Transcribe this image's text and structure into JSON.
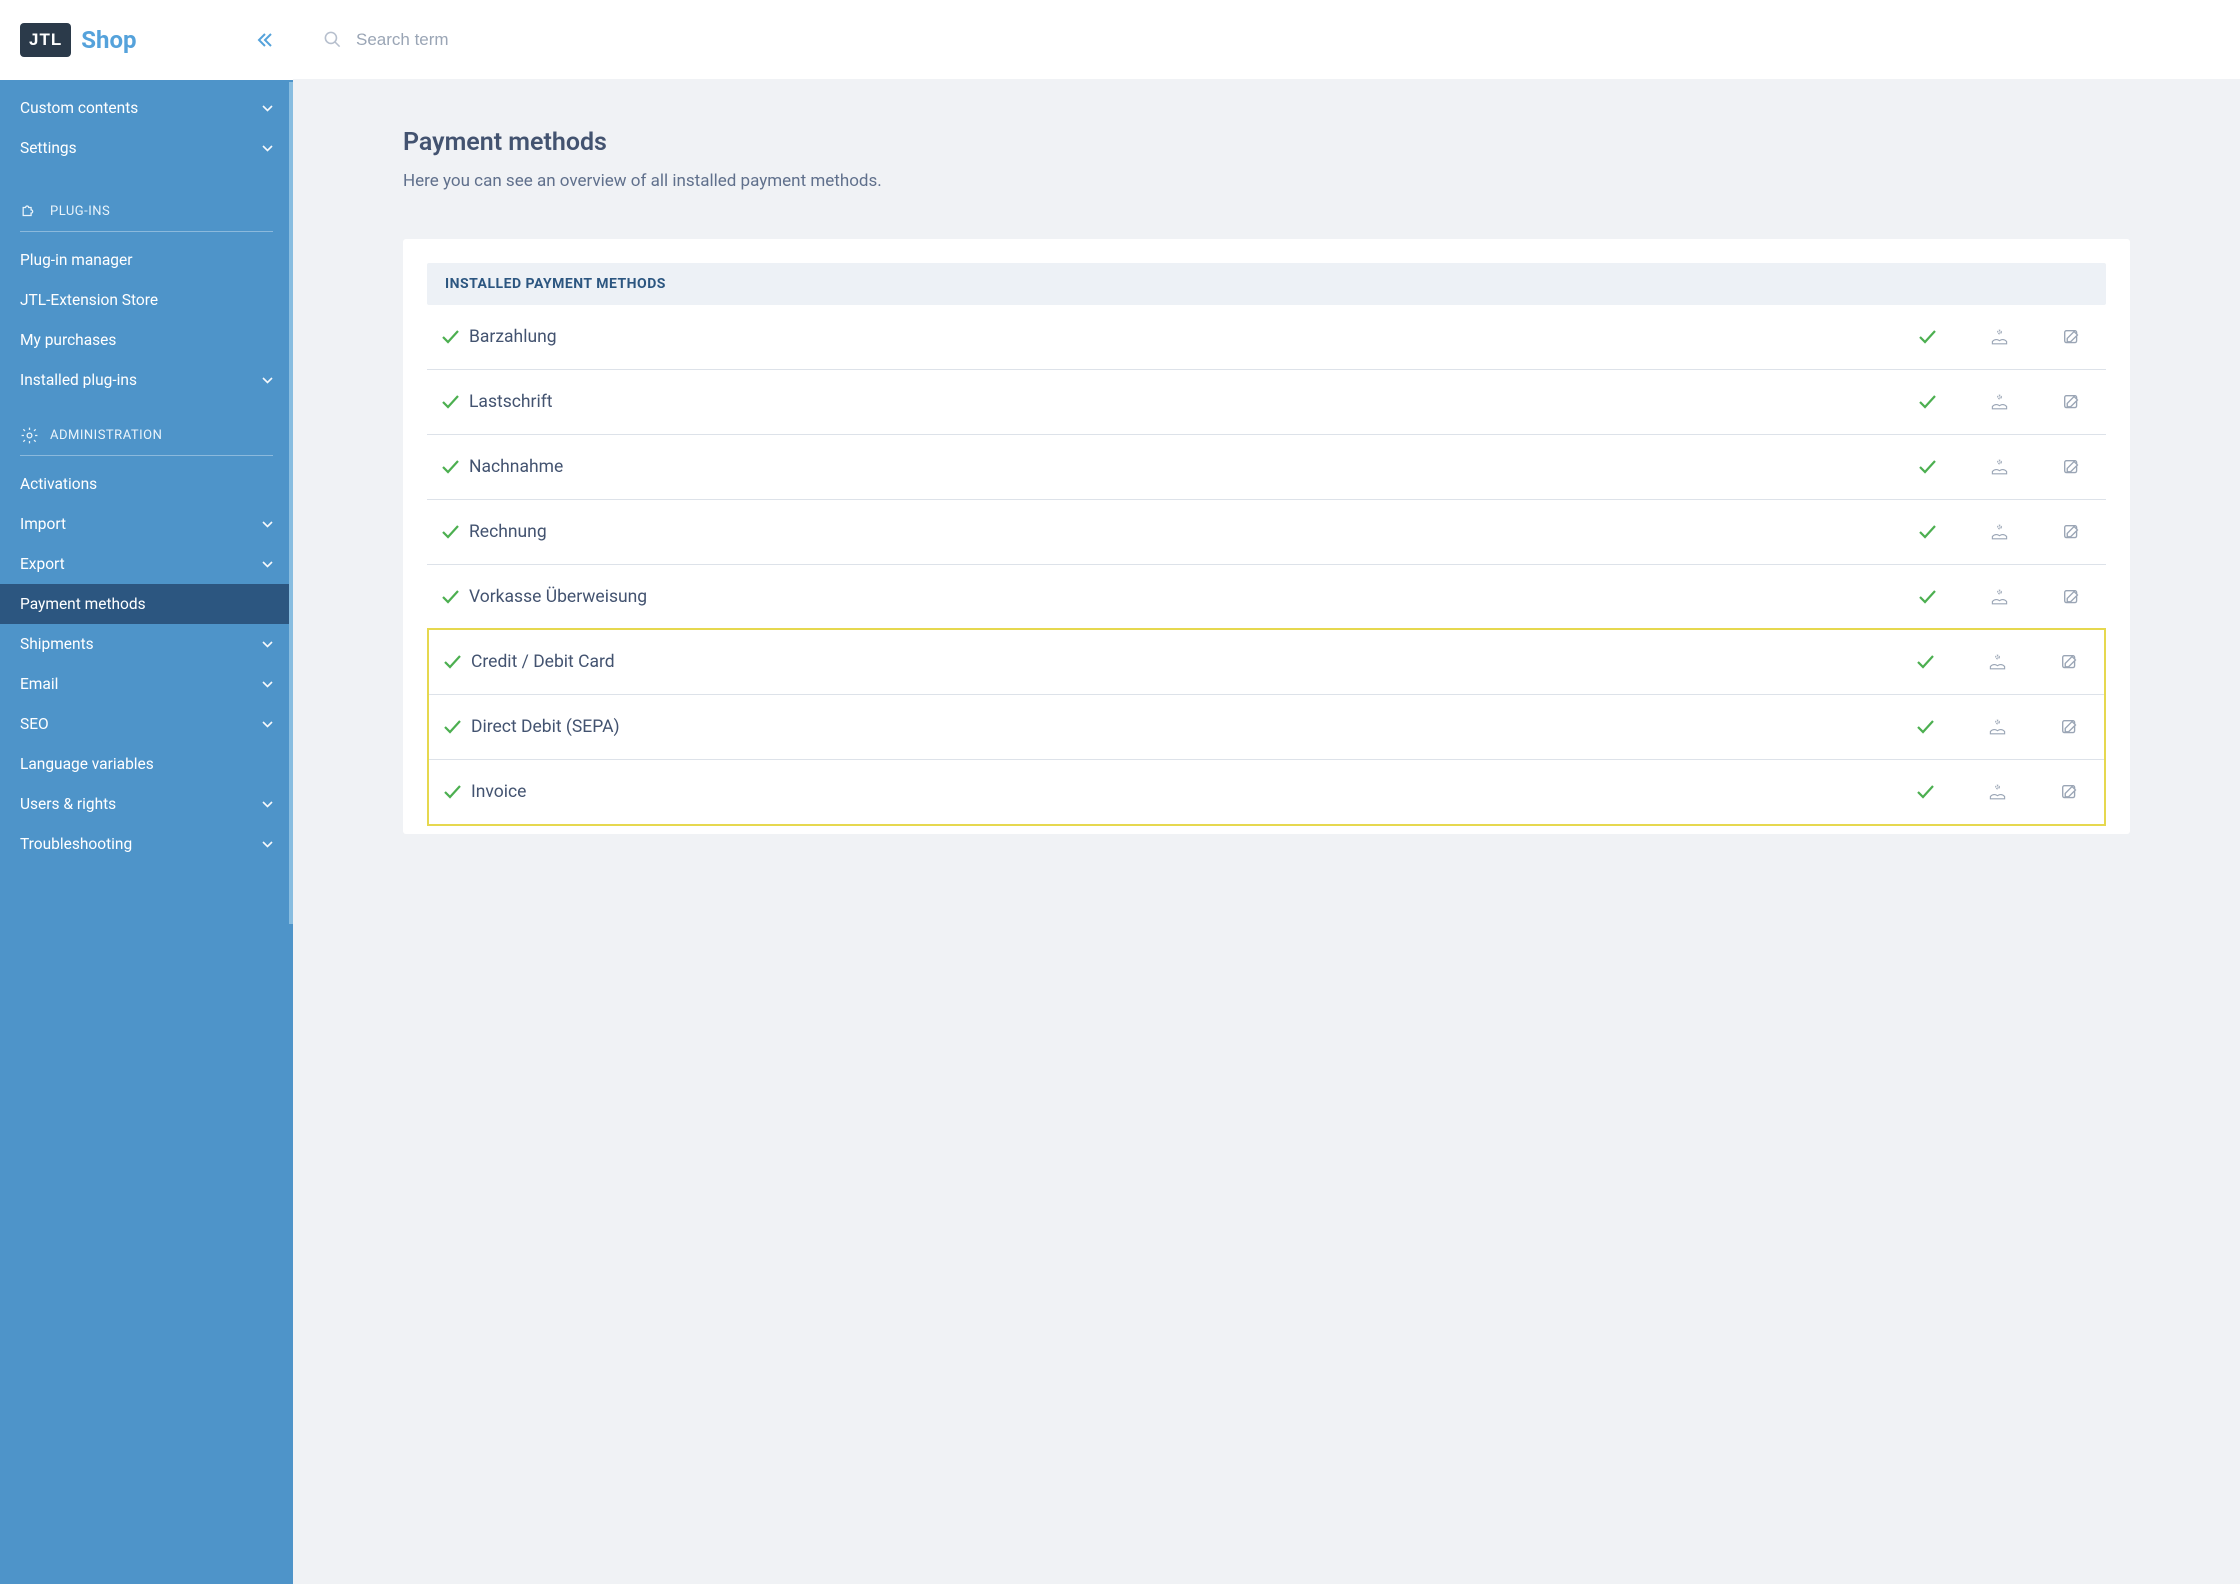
{
  "brand": {
    "logo": "JTL",
    "shop": "Shop"
  },
  "search": {
    "placeholder": "Search term"
  },
  "sidebar": {
    "top_items": [
      {
        "label": "Custom contents",
        "chevron": true
      },
      {
        "label": "Settings",
        "chevron": true
      }
    ],
    "sections": [
      {
        "title": "PLUG-INS",
        "icon": "puzzle",
        "items": [
          {
            "label": "Plug-in manager",
            "chevron": false
          },
          {
            "label": "JTL-Extension Store",
            "chevron": false
          },
          {
            "label": "My purchases",
            "chevron": false
          },
          {
            "label": "Installed plug-ins",
            "chevron": true
          }
        ]
      },
      {
        "title": "ADMINISTRATION",
        "icon": "gear",
        "items": [
          {
            "label": "Activations",
            "chevron": false
          },
          {
            "label": "Import",
            "chevron": true
          },
          {
            "label": "Export",
            "chevron": true
          },
          {
            "label": "Payment methods",
            "chevron": false,
            "active": true
          },
          {
            "label": "Shipments",
            "chevron": true
          },
          {
            "label": "Email",
            "chevron": true
          },
          {
            "label": "SEO",
            "chevron": true
          },
          {
            "label": "Language variables",
            "chevron": false
          },
          {
            "label": "Users & rights",
            "chevron": true
          },
          {
            "label": "Troubleshooting",
            "chevron": true
          }
        ]
      }
    ]
  },
  "page": {
    "title": "Payment methods",
    "subtitle": "Here you can see an overview of all installed payment methods."
  },
  "table": {
    "header": "INSTALLED PAYMENT METHODS",
    "rows": [
      {
        "name": "Barzahlung",
        "highlighted": false
      },
      {
        "name": "Lastschrift",
        "highlighted": false
      },
      {
        "name": "Nachnahme",
        "highlighted": false
      },
      {
        "name": "Rechnung",
        "highlighted": false
      },
      {
        "name": "Vorkasse Überweisung",
        "highlighted": false
      },
      {
        "name": "Credit / Debit Card",
        "highlighted": true
      },
      {
        "name": "Direct Debit (SEPA)",
        "highlighted": true
      },
      {
        "name": "Invoice",
        "highlighted": true
      }
    ]
  }
}
